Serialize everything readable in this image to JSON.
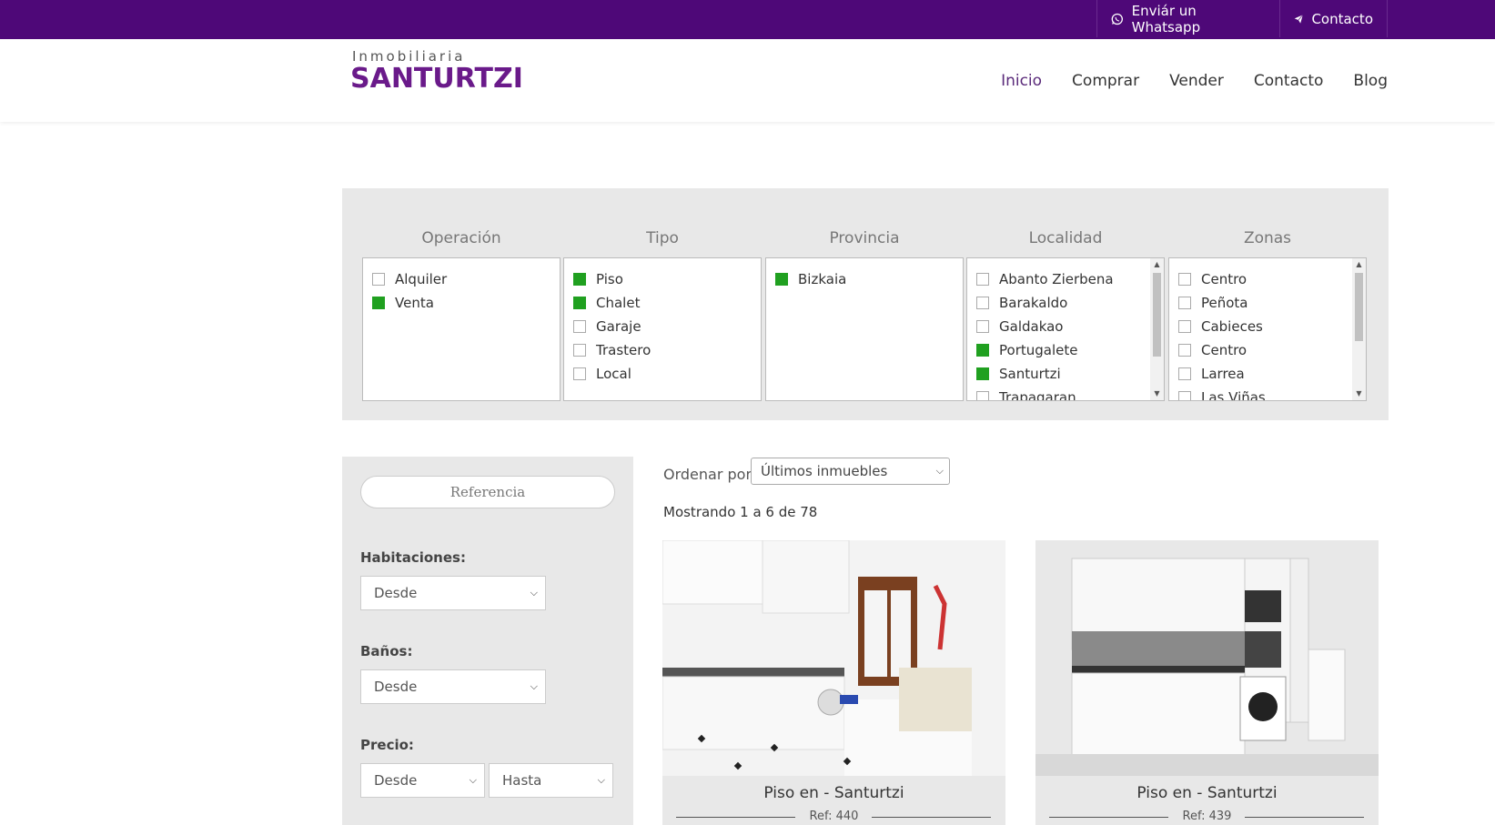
{
  "topbar": {
    "whatsapp_label": "Enviár un Whatsapp",
    "contact_label": "Contacto"
  },
  "logo": {
    "small": "Inmobiliaria",
    "big": "SANTURTZI"
  },
  "nav": {
    "items": [
      "Inicio",
      "Comprar",
      "Vender",
      "Contacto",
      "Blog"
    ]
  },
  "filters": {
    "operacion": {
      "title": "Operación",
      "items": [
        "Alquiler",
        "Venta"
      ]
    },
    "tipo": {
      "title": "Tipo",
      "items": [
        "Piso",
        "Chalet",
        "Garaje",
        "Trastero",
        "Local"
      ]
    },
    "provincia": {
      "title": "Provincia",
      "items": [
        "Bizkaia"
      ]
    },
    "localidad": {
      "title": "Localidad",
      "items": [
        "Abanto Zierbena",
        "Barakaldo",
        "Galdakao",
        "Portugalete",
        "Santurtzi",
        "Trapagaran"
      ]
    },
    "zonas": {
      "title": "Zonas",
      "items": [
        "Centro",
        "Peñota",
        "Cabieces",
        "Centro",
        "Larrea",
        "Las Viñas"
      ]
    }
  },
  "sidebar": {
    "reference_placeholder": "Referencia",
    "rooms_label": "Habitaciones:",
    "rooms_value": "Desde",
    "baths_label": "Baños:",
    "baths_value": "Desde",
    "price_label": "Precio:",
    "price_from": "Desde",
    "price_to": "Hasta"
  },
  "results": {
    "order_label": "Ordenar por:",
    "order_value": "Últimos inmuebles",
    "showing": "Mostrando 1 a 6 de 78",
    "cards": [
      {
        "title": "Piso en - Santurtzi",
        "ref": "Ref: 440"
      },
      {
        "title": "Piso en - Santurtzi",
        "ref": "Ref: 439"
      }
    ]
  },
  "colors": {
    "topbar": "#4e0878",
    "checked": "#20a020",
    "panel": "#e8e8e8"
  }
}
